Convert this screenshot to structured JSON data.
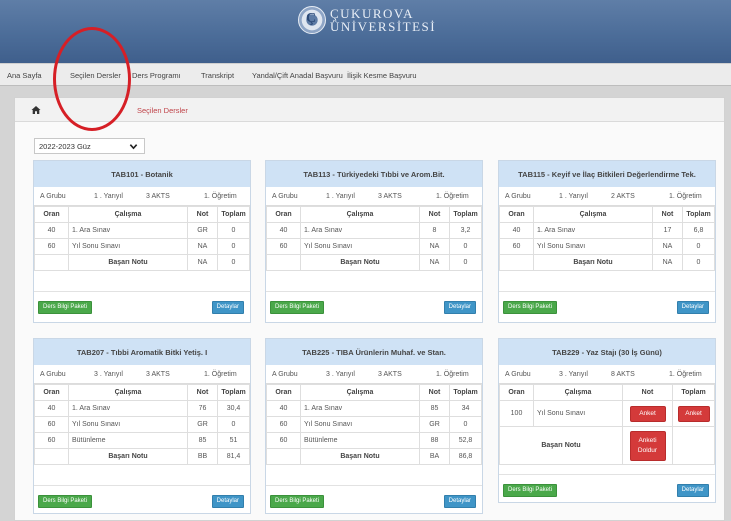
{
  "brand": {
    "line1": "ÇUKUROVA",
    "line2": "ÜNİVERSİTESİ",
    "emblem": "Ç"
  },
  "nav": [
    {
      "label": "Ana Sayfa"
    },
    {
      "label": "Seçilen Dersler"
    },
    {
      "label": "Ders Programı"
    },
    {
      "label": "Transkript"
    },
    {
      "label": "Yandal/Çift Anadal Başvuru"
    },
    {
      "label": "İlişik Kesme Başvuru"
    }
  ],
  "breadcrumb": {
    "current": "Seçilen Dersler"
  },
  "term": {
    "value": "2022-2023 Güz"
  },
  "table_headers": {
    "oran": "Oran",
    "calisma": "Çalışma",
    "not": "Not",
    "toplam": "Toplam"
  },
  "labels": {
    "basari_notu": "Başarı Notu",
    "btn_info": "Ders Bilgi Paketi",
    "btn_details": "Detaylar",
    "anket": "Anket",
    "anket_doldur": "Anketi Doldur"
  },
  "courses": [
    {
      "title": "TAB101 - Botanik",
      "group": "A Grubu",
      "term": "1 . Yarıyıl",
      "akts": "3 AKTS",
      "type": "1. Öğretim",
      "rows": [
        {
          "oran": "40",
          "calisma": "1. Ara Sınav",
          "not": "GR",
          "toplam": "0"
        },
        {
          "oran": "60",
          "calisma": "Yıl Sonu Sınavı",
          "not": "NA",
          "toplam": "0"
        }
      ],
      "final": {
        "not": "NA",
        "toplam": "0"
      }
    },
    {
      "title": "TAB113 - Türkiyedeki Tıbbi ve Arom.Bit.",
      "group": "A Grubu",
      "term": "1 . Yarıyıl",
      "akts": "3 AKTS",
      "type": "1. Öğretim",
      "rows": [
        {
          "oran": "40",
          "calisma": "1. Ara Sınav",
          "not": "8",
          "toplam": "3,2"
        },
        {
          "oran": "60",
          "calisma": "Yıl Sonu Sınavı",
          "not": "NA",
          "toplam": "0"
        }
      ],
      "final": {
        "not": "NA",
        "toplam": "0"
      }
    },
    {
      "title": "TAB115 - Keyif ve İlaç Bitkileri Değerlendirme Tek.",
      "group": "A Grubu",
      "term": "1 . Yarıyıl",
      "akts": "2 AKTS",
      "type": "1. Öğretim",
      "rows": [
        {
          "oran": "40",
          "calisma": "1. Ara Sınav",
          "not": "17",
          "toplam": "6,8"
        },
        {
          "oran": "60",
          "calisma": "Yıl Sonu Sınavı",
          "not": "NA",
          "toplam": "0"
        }
      ],
      "final": {
        "not": "NA",
        "toplam": "0"
      }
    },
    {
      "title": "TAB207 - Tıbbi Aromatik Bitki Yetiş. I",
      "group": "A Grubu",
      "term": "3 . Yarıyıl",
      "akts": "3 AKTS",
      "type": "1. Öğretim",
      "rows": [
        {
          "oran": "40",
          "calisma": "1. Ara Sınav",
          "not": "76",
          "toplam": "30,4"
        },
        {
          "oran": "60",
          "calisma": "Yıl Sonu Sınavı",
          "not": "GR",
          "toplam": "0"
        },
        {
          "oran": "60",
          "calisma": "Bütünleme",
          "not": "85",
          "toplam": "51"
        }
      ],
      "final": {
        "not": "BB",
        "toplam": "81,4"
      }
    },
    {
      "title": "TAB225 - TIBA Ürünlerin Muhaf. ve Stan.",
      "group": "A Grubu",
      "term": "3 . Yarıyıl",
      "akts": "3 AKTS",
      "type": "1. Öğretim",
      "rows": [
        {
          "oran": "40",
          "calisma": "1. Ara Sınav",
          "not": "85",
          "toplam": "34"
        },
        {
          "oran": "60",
          "calisma": "Yıl Sonu Sınavı",
          "not": "GR",
          "toplam": "0"
        },
        {
          "oran": "60",
          "calisma": "Bütünleme",
          "not": "88",
          "toplam": "52,8"
        }
      ],
      "final": {
        "not": "BA",
        "toplam": "86,8"
      }
    },
    {
      "title": "TAB229 - Yaz Stajı (30 İş Günü)",
      "group": "A Grubu",
      "term": "3 . Yarıyıl",
      "akts": "8 AKTS",
      "type": "1. Öğretim",
      "rows": [
        {
          "oran": "100",
          "calisma": "Yıl Sonu Sınavı"
        }
      ]
    }
  ]
}
